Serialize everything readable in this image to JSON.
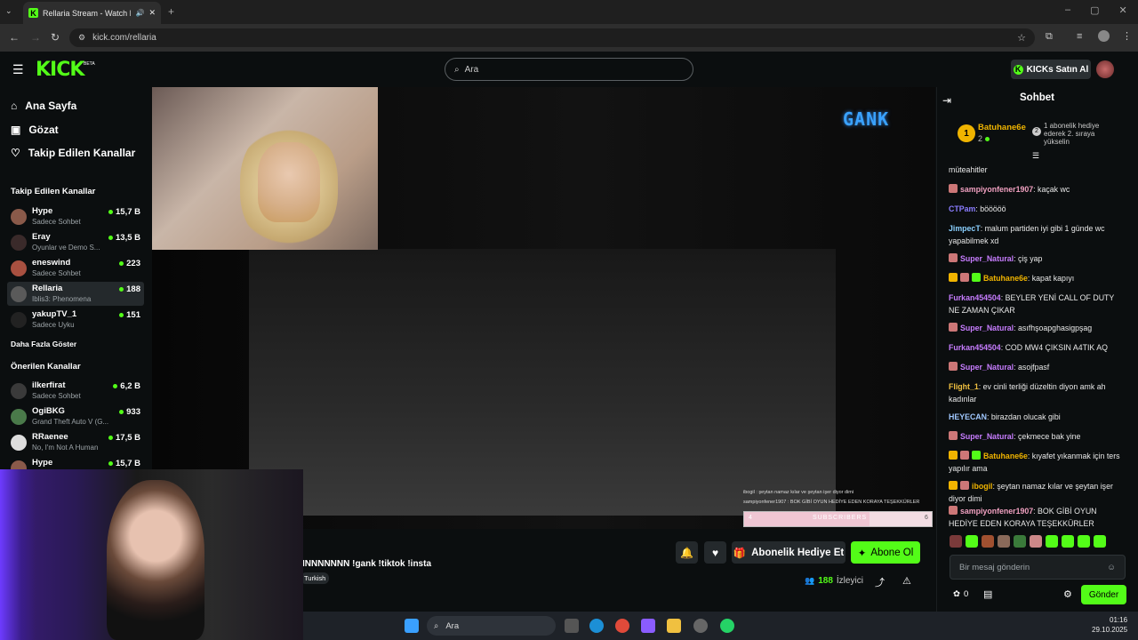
{
  "browser": {
    "tab_title": "Rellaria Stream - Watch Live",
    "url": "kick.com/rellaria"
  },
  "header": {
    "logo": "KICK",
    "beta": "BETA",
    "search_placeholder": "Ara",
    "kicks_button": "KICKs Satın Al"
  },
  "sidebar": {
    "nav": [
      {
        "label": "Ana Sayfa",
        "icon": "home-icon"
      },
      {
        "label": "Gözat",
        "icon": "browse-icon"
      },
      {
        "label": "Takip Edilen Kanallar",
        "icon": "heart-icon"
      }
    ],
    "followed_heading": "Takip Edilen Kanallar",
    "followed": [
      {
        "name": "Hype",
        "sub": "Sadece Sohbet",
        "viewers": "15,7 B",
        "color": "#8a5a4a"
      },
      {
        "name": "Eray",
        "sub": "Oyunlar ve Demo S...",
        "viewers": "13,5 B",
        "color": "#3a2a2a"
      },
      {
        "name": "eneswind",
        "sub": "Sadece Sohbet",
        "viewers": "223",
        "color": "#a85040"
      },
      {
        "name": "Rellaria",
        "sub": "Iblis3: Phenomena",
        "viewers": "188",
        "color": "#5a5a5a"
      },
      {
        "name": "yakupTV_1",
        "sub": "Sadece Uyku",
        "viewers": "151",
        "color": "#222222"
      }
    ],
    "show_more": "Daha Fazla Göster",
    "recommended_heading": "Önerilen Kanallar",
    "recommended": [
      {
        "name": "ilkerfirat",
        "sub": "Sadece Sohbet",
        "viewers": "6,2 B",
        "color": "#3a3a3a"
      },
      {
        "name": "OgiBKG",
        "sub": "Grand Theft Auto V (G...",
        "viewers": "933",
        "color": "#4a7a4a"
      },
      {
        "name": "RRaenee",
        "sub": "No, I'm Not A Human",
        "viewers": "17,5 B",
        "color": "#dddddd"
      },
      {
        "name": "Hype",
        "sub": "",
        "viewers": "15,7 B",
        "color": "#8a5a4a"
      }
    ]
  },
  "video": {
    "overlay_logo": "GANK",
    "overlay_line1": "ibogil : şeytan namaz kılar ve şeytan işer diyor dimi",
    "overlay_line2": "sampiyonfener1907 : BOK GİBİ OYUN HEDİYE EDEN KORAYA TEŞEKKÜRLER",
    "sub_bar_left": "4",
    "sub_bar_label": "SUBSCRIBERS",
    "sub_bar_right": "6",
    "sub_progress": 0.66
  },
  "stream": {
    "title": "INNNNNNN !gank !tiktok !insta",
    "language": "Turkish",
    "gift_button": "Abonelik Hediye Et",
    "subscribe_button": "Abone Ol",
    "viewer_count": "188",
    "viewer_label": "İzleyici"
  },
  "chat": {
    "title": "Sohbet",
    "pinned": {
      "rank": "1",
      "name": "Batuhane6e",
      "count": "2",
      "message": "1 abonelik hediye ederek 2. sıraya yükselin"
    },
    "messages": [
      {
        "user": "",
        "text": "müteahitler",
        "color": "#e8e8e8",
        "badges": []
      },
      {
        "user": "sampiyonfener1907",
        "text": "kaçak wc",
        "color": "#f0a0c0",
        "badges": [
          "#c77"
        ]
      },
      {
        "user": "CTPam",
        "text": "bööööö",
        "color": "#8a7cff",
        "badges": []
      },
      {
        "user": "JimpecT",
        "text": "malum partiden iyi gibi 1 günde wc yapabilmek xd",
        "color": "#8ad0ff",
        "badges": []
      },
      {
        "user": "Super_Natural",
        "text": "çiş yap",
        "color": "#c77dff",
        "badges": [
          "#c77"
        ]
      },
      {
        "user": "Batuhane6e",
        "text": "kapat kapıyı",
        "color": "#f0b400",
        "badges": [
          "#f0b400",
          "#c77",
          "#53fc18"
        ]
      },
      {
        "user": "Furkan454504",
        "text": "BEYLER YENİ CALL OF DUTY NE ZAMAN ÇIKAR",
        "color": "#c77dff",
        "badges": []
      },
      {
        "user": "Super_Natural",
        "text": "asıfhşoapghasigpşag",
        "color": "#c77dff",
        "badges": [
          "#c77"
        ]
      },
      {
        "user": "Furkan454504",
        "text": "COD MW4 ÇIKSIN A4TIK AQ",
        "color": "#c77dff",
        "badges": []
      },
      {
        "user": "Super_Natural",
        "text": "asojfpasf",
        "color": "#c77dff",
        "badges": [
          "#c77"
        ]
      },
      {
        "user": "Flight_1",
        "text": "ev cinli terliği düzeltin diyon amk ah kadınlar",
        "color": "#f0c040",
        "badges": []
      },
      {
        "user": "HEYECAN",
        "text": "birazdan olucak gibi",
        "color": "#a0c8ff",
        "badges": []
      },
      {
        "user": "Super_Natural",
        "text": "çekmece bak yine",
        "color": "#c77dff",
        "badges": [
          "#c77"
        ]
      },
      {
        "user": "Batuhane6e",
        "text": "kıyafet yıkanmak için ters yapılır ama",
        "color": "#f0b400",
        "badges": [
          "#f0b400",
          "#c77",
          "#53fc18"
        ]
      },
      {
        "user": "ibogil",
        "text": "şeytan namaz kılar ve şeytan işer diyor dimi",
        "color": "#f0b400",
        "badges": [
          "#f0b400",
          "#c77"
        ]
      },
      {
        "user": "sampiyonfener1907",
        "text": "BOK GİBİ OYUN HEDİYE EDEN KORAYA TEŞEKKÜRLER",
        "color": "#f0a0c0",
        "badges": [
          "#c77"
        ]
      }
    ],
    "input_placeholder": "Bir mesaj gönderin",
    "kicks_count": "0",
    "send_button": "Gönder"
  },
  "taskbar": {
    "search": "Ara",
    "time": "01:16",
    "date": "29.10.2025"
  },
  "colors": {
    "accent": "#53fc18",
    "bg": "#0b0e0f"
  }
}
